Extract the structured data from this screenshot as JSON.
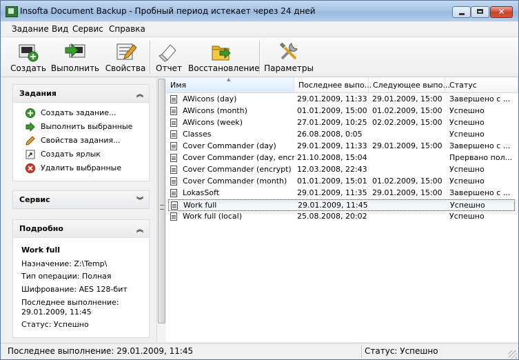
{
  "window": {
    "title": "Insofta Document Backup - Пробный период истекает через 24 дней",
    "close_glyph": "✕"
  },
  "menu": [
    "Задание",
    "Вид",
    "Сервис",
    "Справка"
  ],
  "toolbar": {
    "create": "Создать",
    "run": "Выполнить",
    "properties": "Свойства",
    "report": "Отчет",
    "restore": "Восстановление",
    "settings": "Параметры"
  },
  "tasks_panel": {
    "title": "Задания",
    "items": [
      {
        "label": "Создать задание...",
        "icon": "add-icon"
      },
      {
        "label": "Выполнить выбранные",
        "icon": "arrow-right-icon"
      },
      {
        "label": "Свойства задания...",
        "icon": "pencil-icon"
      },
      {
        "label": "Создать ярлык",
        "icon": "shortcut-icon"
      },
      {
        "label": "Удалить выбранные",
        "icon": "delete-icon"
      }
    ]
  },
  "service_panel": {
    "title": "Сервис"
  },
  "details_panel": {
    "title": "Подробно",
    "name": "Work full",
    "destination": "Назначение: Z:\\Temp\\",
    "operation": "Тип операции: Полная",
    "encryption": "Шифрование: AES 128-бит",
    "last_run_label": "Последнее выполнение:",
    "last_run_value": "29.01.2009, 11:45",
    "status": "Статус: Успешно"
  },
  "list": {
    "columns": [
      "Имя",
      "Последнее выпо...",
      "Следующее выпо...",
      "Статус"
    ],
    "rows": [
      {
        "name": "AWicons (day)",
        "last": "29.01.2009, 11:33",
        "next": "29.01.2009, 15:00",
        "status": "Завершено с ..."
      },
      {
        "name": "AWicons (month)",
        "last": "01.01.2009, 15:00",
        "next": "01.02.2009, 15:00",
        "status": "Успешно"
      },
      {
        "name": "AWicons (week)",
        "last": "27.01.2009, 10:25",
        "next": "02.02.2009, 15:00",
        "status": "Успешно"
      },
      {
        "name": "Classes",
        "last": "26.08.2008, 0:05",
        "next": "",
        "status": "Успешно"
      },
      {
        "name": "Cover Commander (day)",
        "last": "29.01.2009, 11:33",
        "next": "29.01.2009, 15:00",
        "status": "Завершено с ..."
      },
      {
        "name": "Cover Commander (day, encr...",
        "last": "21.10.2008, 15:04",
        "next": "",
        "status": "Прервано пол..."
      },
      {
        "name": "Cover Commander (encrypt)",
        "last": "12.03.2008, 22:43",
        "next": "",
        "status": "Успешно"
      },
      {
        "name": "Cover Commander (month)",
        "last": "01.01.2009, 15:01",
        "next": "01.02.2009, 15:00",
        "status": "Успешно"
      },
      {
        "name": "LokasSoft",
        "last": "29.01.2009, 11:35",
        "next": "29.01.2009, 15:00",
        "status": "Завершено с ..."
      },
      {
        "name": "Work full",
        "last": "29.01.2009, 11:45",
        "next": "",
        "status": "Успешно"
      },
      {
        "name": "Work full (local)",
        "last": "25.08.2008, 20:02",
        "next": "",
        "status": "Успешно"
      }
    ],
    "selected_index": 9
  },
  "statusbar": {
    "left": "Последнее выполнение: 29.01.2009, 11:45",
    "right": "Статус: Успешно"
  }
}
